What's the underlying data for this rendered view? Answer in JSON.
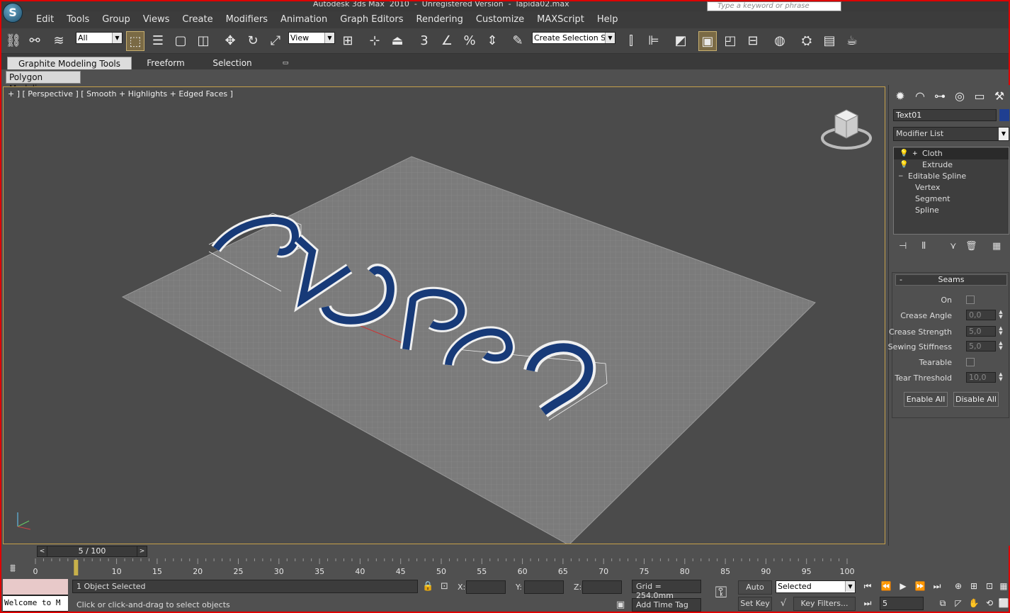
{
  "window": {
    "title": "Autodesk 3ds Max  2010  -  Unregistered Version  -  lapida02.max",
    "logo_letter": "S"
  },
  "search": {
    "placeholder": "Type a keyword or phrase"
  },
  "menu": [
    "Edit",
    "Tools",
    "Group",
    "Views",
    "Create",
    "Modifiers",
    "Animation",
    "Graph Editors",
    "Rendering",
    "Customize",
    "MAXScript",
    "Help"
  ],
  "toolbar": {
    "filter_select": "All",
    "refcoord_select": "View",
    "snap_label": "3",
    "selection_set": "Create Selection Se"
  },
  "ribbon": {
    "tabs": [
      "Graphite Modeling Tools",
      "Freeform",
      "Selection"
    ],
    "active_panel": "Polygon Modeling"
  },
  "viewport": {
    "label": "+ ] [ Perspective ] [ Smooth + Highlights + Edged Faces ]",
    "text_object": "2023",
    "colors": {
      "text": "#173a78",
      "plane": "#7a7a7a",
      "background": "#4b4b4b",
      "frame": "#c5a04a"
    }
  },
  "command_panel": {
    "object_name": "Text01",
    "object_color": "#1f3f91",
    "modifier_list": "Modifier List",
    "stack": [
      {
        "label": "Cloth",
        "indent": 1,
        "selected": true,
        "expand": "+"
      },
      {
        "label": "Extrude",
        "indent": 1,
        "selected": false
      },
      {
        "label": "Editable Spline",
        "indent": 0,
        "selected": false,
        "expand": "−"
      },
      {
        "label": "Vertex",
        "indent": 2,
        "selected": false
      },
      {
        "label": "Segment",
        "indent": 2,
        "selected": false
      },
      {
        "label": "Spline",
        "indent": 2,
        "selected": false
      }
    ],
    "seams": {
      "title": "Seams",
      "collapse": "-",
      "on_label": "On",
      "crease_angle_label": "Crease Angle",
      "crease_angle": "0,0",
      "crease_strength_label": "Crease Strength",
      "crease_strength": "5,0",
      "sewing_stiffness_label": "Sewing Stiffness",
      "sewing_stiffness": "5,0",
      "tearable_label": "Tearable",
      "tear_threshold_label": "Tear Threshold",
      "tear_threshold": "10,0",
      "enable_all": "Enable All",
      "disable_all": "Disable All"
    }
  },
  "timeline": {
    "slider": "5 / 100",
    "current_frame": 5,
    "ticks": [
      "0",
      "5",
      "10",
      "15",
      "20",
      "25",
      "30",
      "35",
      "40",
      "45",
      "50",
      "55",
      "60",
      "65",
      "70",
      "75",
      "80",
      "85",
      "90",
      "95",
      "100"
    ]
  },
  "status": {
    "maxscript": "Welcome to M",
    "selection": "1 Object Selected",
    "prompt": "Click or click-and-drag to select objects",
    "x_label": "X:",
    "y_label": "Y:",
    "z_label": "Z:",
    "grid": "Grid = 254,0mm",
    "add_time_tag": "Add Time Tag",
    "auto_key": "Auto Key",
    "set_key": "Set Key",
    "key_mode": "Selected",
    "key_filters": "Key Filters...",
    "frame_field": "5"
  }
}
